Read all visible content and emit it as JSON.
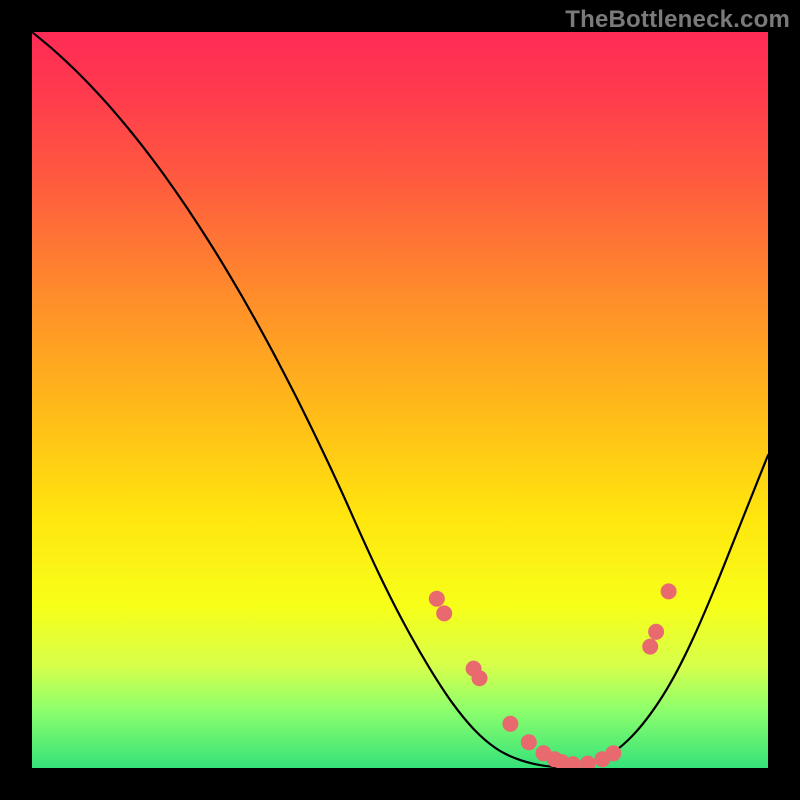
{
  "watermark": "TheBottleneck.com",
  "colors": {
    "dot": "#e86a6f",
    "line": "#000000",
    "gradient_top": "#ff2b56",
    "gradient_bottom": "#35e27a",
    "frame": "#000000"
  },
  "chart_data": {
    "type": "line",
    "title": "",
    "xlabel": "",
    "ylabel": "",
    "xlim": [
      0,
      100
    ],
    "ylim": [
      0,
      100
    ],
    "grid": false,
    "series": [
      {
        "name": "curve",
        "x": [
          0,
          3,
          6,
          9,
          12,
          15,
          18,
          21,
          24,
          27,
          30,
          33,
          36,
          39,
          42,
          45,
          48,
          51,
          54,
          57,
          60,
          63,
          66,
          69,
          72,
          75,
          78,
          81,
          84,
          87,
          90,
          93,
          96,
          99,
          100
        ],
        "y": [
          100,
          97.5,
          94.7,
          91.6,
          88.2,
          84.5,
          80.5,
          76.2,
          71.6,
          66.7,
          61.5,
          56.0,
          50.2,
          44.1,
          37.7,
          31.0,
          24.6,
          18.8,
          13.6,
          9.0,
          5.3,
          2.7,
          1.2,
          0.4,
          0.1,
          0.4,
          1.5,
          3.8,
          7.3,
          12.0,
          18.0,
          25.0,
          32.5,
          40.0,
          42.5
        ]
      }
    ],
    "markers": [
      {
        "x": 55.0,
        "y": 23.0
      },
      {
        "x": 56.0,
        "y": 21.0
      },
      {
        "x": 60.0,
        "y": 13.5
      },
      {
        "x": 60.8,
        "y": 12.2
      },
      {
        "x": 65.0,
        "y": 6.0
      },
      {
        "x": 67.5,
        "y": 3.5
      },
      {
        "x": 69.5,
        "y": 2.0
      },
      {
        "x": 71.0,
        "y": 1.2
      },
      {
        "x": 72.0,
        "y": 0.8
      },
      {
        "x": 73.5,
        "y": 0.5
      },
      {
        "x": 75.5,
        "y": 0.6
      },
      {
        "x": 77.5,
        "y": 1.2
      },
      {
        "x": 79.0,
        "y": 2.0
      },
      {
        "x": 84.0,
        "y": 16.5
      },
      {
        "x": 84.8,
        "y": 18.5
      },
      {
        "x": 86.5,
        "y": 24.0
      }
    ]
  }
}
